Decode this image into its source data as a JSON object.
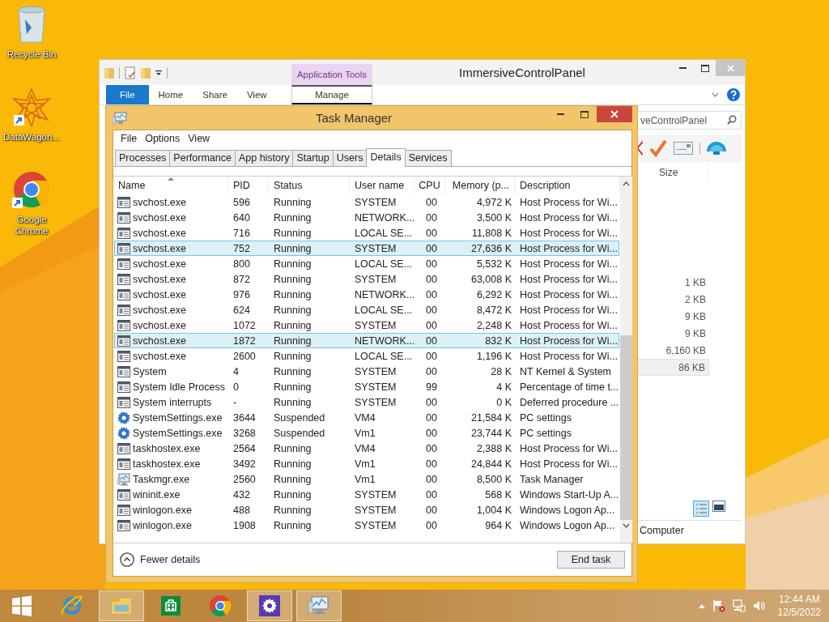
{
  "desktop_icons": [
    {
      "kind": "recycle",
      "label": "Recycle Bin"
    },
    {
      "kind": "wagon",
      "label": "DataWagon..."
    },
    {
      "kind": "chrome",
      "label": "Google Chrome"
    }
  ],
  "explorer": {
    "title": "ImmersiveControlPanel",
    "context_group": "Application Tools",
    "file_tab": "File",
    "ribbon_tabs": [
      "Home",
      "Share",
      "View"
    ],
    "context_tab": "Manage",
    "search": {
      "placeholder": "veControlPanel"
    },
    "size_column": "Size",
    "sizes": [
      {
        "text": "1 KB",
        "selected": false
      },
      {
        "text": "2 KB",
        "selected": false
      },
      {
        "text": "9 KB",
        "selected": false
      },
      {
        "text": "9 KB",
        "selected": false
      },
      {
        "text": "6,160 KB",
        "selected": false
      },
      {
        "text": "86 KB",
        "selected": true
      }
    ],
    "status": "Computer"
  },
  "task_manager": {
    "title": "Task Manager",
    "menu": [
      "File",
      "Options",
      "View"
    ],
    "tabs": [
      {
        "label": "Processes",
        "selected": false
      },
      {
        "label": "Performance",
        "selected": false
      },
      {
        "label": "App history",
        "selected": false
      },
      {
        "label": "Startup",
        "selected": false
      },
      {
        "label": "Users",
        "selected": false
      },
      {
        "label": "Details",
        "selected": true
      },
      {
        "label": "Services",
        "selected": false
      }
    ],
    "columns": [
      {
        "label": "Name",
        "sorted": true
      },
      {
        "label": "PID",
        "sorted": false
      },
      {
        "label": "Status",
        "sorted": false
      },
      {
        "label": "User name",
        "sorted": false
      },
      {
        "label": "CPU",
        "sorted": false
      },
      {
        "label": "Memory (p...",
        "sorted": false
      },
      {
        "label": "Description",
        "sorted": false
      }
    ],
    "rows": [
      {
        "kind": "app",
        "name": "svchost.exe",
        "pid": "596",
        "status": "Running",
        "user": "SYSTEM",
        "cpu": "00",
        "memory": "4,972 K",
        "description": "Host Process for Wi...",
        "selected": false
      },
      {
        "kind": "app",
        "name": "svchost.exe",
        "pid": "640",
        "status": "Running",
        "user": "NETWORK...",
        "cpu": "00",
        "memory": "3,500 K",
        "description": "Host Process for Wi...",
        "selected": false
      },
      {
        "kind": "app",
        "name": "svchost.exe",
        "pid": "716",
        "status": "Running",
        "user": "LOCAL SE...",
        "cpu": "00",
        "memory": "11,808 K",
        "description": "Host Process for Wi...",
        "selected": false
      },
      {
        "kind": "app",
        "name": "svchost.exe",
        "pid": "752",
        "status": "Running",
        "user": "SYSTEM",
        "cpu": "00",
        "memory": "27,636 K",
        "description": "Host Process for Wi...",
        "selected": true
      },
      {
        "kind": "app",
        "name": "svchost.exe",
        "pid": "800",
        "status": "Running",
        "user": "LOCAL SE...",
        "cpu": "00",
        "memory": "5,532 K",
        "description": "Host Process for Wi...",
        "selected": false
      },
      {
        "kind": "app",
        "name": "svchost.exe",
        "pid": "872",
        "status": "Running",
        "user": "SYSTEM",
        "cpu": "00",
        "memory": "63,008 K",
        "description": "Host Process for Wi...",
        "selected": false
      },
      {
        "kind": "app",
        "name": "svchost.exe",
        "pid": "976",
        "status": "Running",
        "user": "NETWORK...",
        "cpu": "00",
        "memory": "6,292 K",
        "description": "Host Process for Wi...",
        "selected": false
      },
      {
        "kind": "app",
        "name": "svchost.exe",
        "pid": "624",
        "status": "Running",
        "user": "LOCAL SE...",
        "cpu": "00",
        "memory": "8,472 K",
        "description": "Host Process for Wi...",
        "selected": false
      },
      {
        "kind": "app",
        "name": "svchost.exe",
        "pid": "1072",
        "status": "Running",
        "user": "SYSTEM",
        "cpu": "00",
        "memory": "2,248 K",
        "description": "Host Process for Wi...",
        "selected": false
      },
      {
        "kind": "app",
        "name": "svchost.exe",
        "pid": "1872",
        "status": "Running",
        "user": "NETWORK...",
        "cpu": "00",
        "memory": "832 K",
        "description": "Host Process for Wi...",
        "selected": true
      },
      {
        "kind": "app",
        "name": "svchost.exe",
        "pid": "2600",
        "status": "Running",
        "user": "LOCAL SE...",
        "cpu": "00",
        "memory": "1,196 K",
        "description": "Host Process for Wi...",
        "selected": false
      },
      {
        "kind": "app",
        "name": "System",
        "pid": "4",
        "status": "Running",
        "user": "SYSTEM",
        "cpu": "00",
        "memory": "28 K",
        "description": "NT Kernel & System",
        "selected": false
      },
      {
        "kind": "app",
        "name": "System Idle Process",
        "pid": "0",
        "status": "Running",
        "user": "SYSTEM",
        "cpu": "99",
        "memory": "4 K",
        "description": "Percentage of time t...",
        "selected": false
      },
      {
        "kind": "app",
        "name": "System interrupts",
        "pid": "-",
        "status": "Running",
        "user": "SYSTEM",
        "cpu": "00",
        "memory": "0 K",
        "description": "Deferred procedure ...",
        "selected": false
      },
      {
        "kind": "settings",
        "name": "SystemSettings.exe",
        "pid": "3644",
        "status": "Suspended",
        "user": "VM4",
        "cpu": "00",
        "memory": "21,584 K",
        "description": "PC settings",
        "selected": false
      },
      {
        "kind": "settings",
        "name": "SystemSettings.exe",
        "pid": "3268",
        "status": "Suspended",
        "user": "Vm1",
        "cpu": "00",
        "memory": "23,744 K",
        "description": "PC settings",
        "selected": false
      },
      {
        "kind": "app",
        "name": "taskhostex.exe",
        "pid": "2564",
        "status": "Running",
        "user": "VM4",
        "cpu": "00",
        "memory": "2,388 K",
        "description": "Host Process for Wi...",
        "selected": false
      },
      {
        "kind": "app",
        "name": "taskhostex.exe",
        "pid": "3492",
        "status": "Running",
        "user": "Vm1",
        "cpu": "00",
        "memory": "24,844 K",
        "description": "Host Process for Wi...",
        "selected": false
      },
      {
        "kind": "monitor",
        "name": "Taskmgr.exe",
        "pid": "2560",
        "status": "Running",
        "user": "Vm1",
        "cpu": "00",
        "memory": "8,500 K",
        "description": "Task Manager",
        "selected": false
      },
      {
        "kind": "app",
        "name": "wininit.exe",
        "pid": "432",
        "status": "Running",
        "user": "SYSTEM",
        "cpu": "00",
        "memory": "568 K",
        "description": "Windows Start-Up A...",
        "selected": false
      },
      {
        "kind": "app",
        "name": "winlogon.exe",
        "pid": "488",
        "status": "Running",
        "user": "SYSTEM",
        "cpu": "00",
        "memory": "1,004 K",
        "description": "Windows Logon Ap...",
        "selected": false
      },
      {
        "kind": "app",
        "name": "winlogon.exe",
        "pid": "1908",
        "status": "Running",
        "user": "SYSTEM",
        "cpu": "00",
        "memory": "964 K",
        "description": "Windows Logon Ap...",
        "selected": false
      }
    ],
    "fewer_details": "Fewer details",
    "end_task": "End task"
  },
  "taskbar": {
    "apps": [
      {
        "kind": "start",
        "open": false
      },
      {
        "kind": "ie",
        "open": false
      },
      {
        "kind": "explorer",
        "open": true
      },
      {
        "kind": "store",
        "open": false
      },
      {
        "kind": "chrome",
        "open": false
      },
      {
        "kind": "settings",
        "open": true
      },
      {
        "kind": "monitor",
        "open": true
      }
    ],
    "time": "12:44 AM",
    "date": "12/5/2022"
  }
}
